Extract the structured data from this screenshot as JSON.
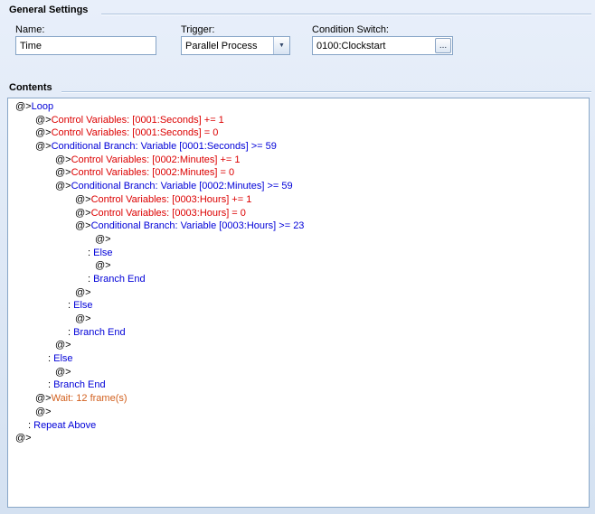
{
  "general": {
    "title": "General Settings",
    "name": {
      "label": "Name:",
      "value": "Time"
    },
    "trigger": {
      "label": "Trigger:",
      "value": "Parallel Process"
    },
    "condition_switch": {
      "label": "Condition Switch:",
      "value": "0100:Clockstart",
      "browse_label": "..."
    }
  },
  "contents": {
    "title": "Contents",
    "colors": {
      "blue": "#0000d8",
      "red": "#dc0000",
      "orange": "#d2601e",
      "black": "#000000"
    },
    "lines": [
      {
        "kind": "cmd",
        "indent": 0,
        "pre": "@>",
        "text": "Loop",
        "color": "blue"
      },
      {
        "kind": "cmd",
        "indent": 1,
        "pre": "@>",
        "text": "Control Variables: [0001:Seconds] += 1",
        "color": "red"
      },
      {
        "kind": "cmd",
        "indent": 1,
        "pre": "@>",
        "text": "Control Variables: [0001:Seconds] = 0",
        "color": "red"
      },
      {
        "kind": "cmd",
        "indent": 1,
        "pre": "@>",
        "text": "Conditional Branch: Variable [0001:Seconds] >= 59",
        "color": "blue"
      },
      {
        "kind": "cmd",
        "indent": 2,
        "pre": "@>",
        "text": "Control Variables: [0002:Minutes] += 1",
        "color": "red"
      },
      {
        "kind": "cmd",
        "indent": 2,
        "pre": "@>",
        "text": "Control Variables: [0002:Minutes] = 0",
        "color": "red"
      },
      {
        "kind": "cmd",
        "indent": 2,
        "pre": "@>",
        "text": "Conditional Branch: Variable [0002:Minutes] >= 59",
        "color": "blue"
      },
      {
        "kind": "cmd",
        "indent": 3,
        "pre": "@>",
        "text": "Control Variables: [0003:Hours] += 1",
        "color": "red"
      },
      {
        "kind": "cmd",
        "indent": 3,
        "pre": "@>",
        "text": "Control Variables: [0003:Hours] = 0",
        "color": "red"
      },
      {
        "kind": "cmd",
        "indent": 3,
        "pre": "@>",
        "text": "Conditional Branch: Variable [0003:Hours] >= 23",
        "color": "blue"
      },
      {
        "kind": "cmd",
        "indent": 4,
        "pre": "@>",
        "text": "",
        "color": "black"
      },
      {
        "kind": "branch",
        "indent": 3,
        "pre": ": ",
        "text": "Else",
        "color": "blue"
      },
      {
        "kind": "cmd",
        "indent": 4,
        "pre": "@>",
        "text": "",
        "color": "black"
      },
      {
        "kind": "branch",
        "indent": 3,
        "pre": ": ",
        "text": "Branch End",
        "color": "blue"
      },
      {
        "kind": "cmd",
        "indent": 3,
        "pre": "@>",
        "text": "",
        "color": "black"
      },
      {
        "kind": "branch",
        "indent": 2,
        "pre": ": ",
        "text": "Else",
        "color": "blue"
      },
      {
        "kind": "cmd",
        "indent": 3,
        "pre": "@>",
        "text": "",
        "color": "black"
      },
      {
        "kind": "branch",
        "indent": 2,
        "pre": ": ",
        "text": "Branch End",
        "color": "blue"
      },
      {
        "kind": "cmd",
        "indent": 2,
        "pre": "@>",
        "text": "",
        "color": "black"
      },
      {
        "kind": "branch",
        "indent": 1,
        "pre": ": ",
        "text": "Else",
        "color": "blue"
      },
      {
        "kind": "cmd",
        "indent": 2,
        "pre": "@>",
        "text": "",
        "color": "black"
      },
      {
        "kind": "branch",
        "indent": 1,
        "pre": ": ",
        "text": "Branch End",
        "color": "blue"
      },
      {
        "kind": "cmd",
        "indent": 1,
        "pre": "@>",
        "text": "Wait: 12 frame(s)",
        "color": "orange"
      },
      {
        "kind": "cmd",
        "indent": 1,
        "pre": "@>",
        "text": "",
        "color": "black"
      },
      {
        "kind": "branch",
        "indent": 0,
        "pre": ": ",
        "text": "Repeat Above",
        "color": "blue"
      },
      {
        "kind": "cmd",
        "indent": 0,
        "pre": "@>",
        "text": "",
        "color": "black"
      }
    ]
  }
}
